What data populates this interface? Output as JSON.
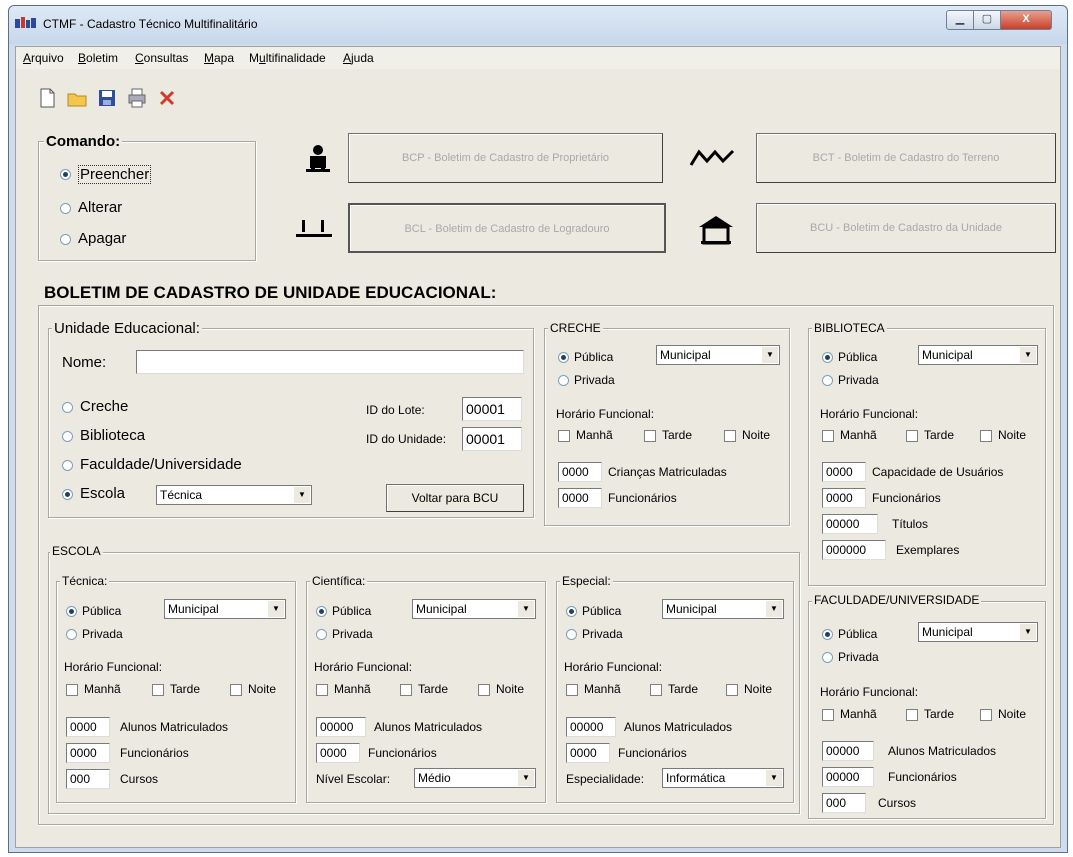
{
  "window": {
    "title": "CTMF - Cadastro Técnico Multifinalitário",
    "close_label": "X"
  },
  "menu": [
    "Arquivo",
    "Boletim",
    "Consultas",
    "Mapa",
    "Multifinalidade",
    "Ajuda"
  ],
  "toolbar": {
    "icons": [
      "new-file-icon",
      "open-folder-icon",
      "save-icon",
      "print-icon",
      "delete-icon"
    ]
  },
  "comando": {
    "title": "Comando:",
    "options": [
      "Preencher",
      "Alterar",
      "Apagar"
    ],
    "selected": "Preencher"
  },
  "boletins": {
    "bcp": "BCP - Boletim de Cadastro de Proprietário",
    "bct": "BCT - Boletim de Cadastro do Terreno",
    "bcl": "BCL - Boletim de Cadastro de Logradouro",
    "bcu": "BCU - Boletim de Cadastro da Unidade"
  },
  "heading": "BOLETIM DE CADASTRO DE UNIDADE EDUCACIONAL:",
  "unidade": {
    "title": "Unidade Educacional:",
    "nome_label": "Nome:",
    "nome_value": "",
    "options": [
      "Creche",
      "Biblioteca",
      "Faculdade/Universidade",
      "Escola"
    ],
    "selected": "Escola",
    "escola_tipo": "Técnica",
    "id_lote_label": "ID do Lote:",
    "id_lote": "00001",
    "id_unidade_label": "ID do Unidade:",
    "id_unidade": "00001",
    "voltar": "Voltar para BCU"
  },
  "creche": {
    "title": "CRECHE",
    "publica": "Pública",
    "privada": "Privada",
    "esfera": "Municipal",
    "horario": "Horário Funcional:",
    "manha": "Manhã",
    "tarde": "Tarde",
    "noite": "Noite",
    "criancas": "0000",
    "criancas_label": "Crianças Matriculadas",
    "funcionarios": "0000",
    "funcionarios_label": "Funcionários"
  },
  "biblioteca": {
    "title": "BIBLIOTECA",
    "publica": "Pública",
    "privada": "Privada",
    "esfera": "Municipal",
    "horario": "Horário Funcional:",
    "manha": "Manhã",
    "tarde": "Tarde",
    "noite": "Noite",
    "capacidade": "0000",
    "capacidade_label": "Capacidade de Usuários",
    "funcionarios": "0000",
    "funcionarios_label": "Funcionários",
    "titulos": "00000",
    "titulos_label": "Títulos",
    "exemplares": "000000",
    "exemplares_label": "Exemplares"
  },
  "escola": {
    "title": "ESCOLA",
    "tecnica": {
      "title": "Técnica:",
      "publica": "Pública",
      "privada": "Privada",
      "esfera": "Municipal",
      "horario": "Horário Funcional:",
      "manha": "Manhã",
      "tarde": "Tarde",
      "noite": "Noite",
      "alunos": "0000",
      "alunos_label": "Alunos Matriculados",
      "funcionarios": "0000",
      "funcionarios_label": "Funcionários",
      "cursos": "000",
      "cursos_label": "Cursos"
    },
    "cientifica": {
      "title": "Científica:",
      "publica": "Pública",
      "privada": "Privada",
      "esfera": "Municipal",
      "horario": "Horário Funcional:",
      "manha": "Manhã",
      "tarde": "Tarde",
      "noite": "Noite",
      "alunos": "00000",
      "alunos_label": "Alunos Matriculados",
      "funcionarios": "0000",
      "funcionarios_label": "Funcionários",
      "nivel_label": "Nível Escolar:",
      "nivel": "Médio"
    },
    "especial": {
      "title": "Especial:",
      "publica": "Pública",
      "privada": "Privada",
      "esfera": "Municipal",
      "horario": "Horário Funcional:",
      "manha": "Manhã",
      "tarde": "Tarde",
      "noite": "Noite",
      "alunos": "00000",
      "alunos_label": "Alunos Matriculados",
      "funcionarios": "0000",
      "funcionarios_label": "Funcionários",
      "especialidade_label": "Especialidade:",
      "especialidade": "Informática"
    }
  },
  "faculdade": {
    "title": "FACULDADE/UNIVERSIDADE",
    "publica": "Pública",
    "privada": "Privada",
    "esfera": "Municipal",
    "horario": "Horário Funcional:",
    "manha": "Manhã",
    "tarde": "Tarde",
    "noite": "Noite",
    "alunos": "00000",
    "alunos_label": "Alunos Matriculados",
    "funcionarios": "00000",
    "funcionarios_label": "Funcionários",
    "cursos": "000",
    "cursos_label": "Cursos"
  },
  "combo_arrow": "▼"
}
